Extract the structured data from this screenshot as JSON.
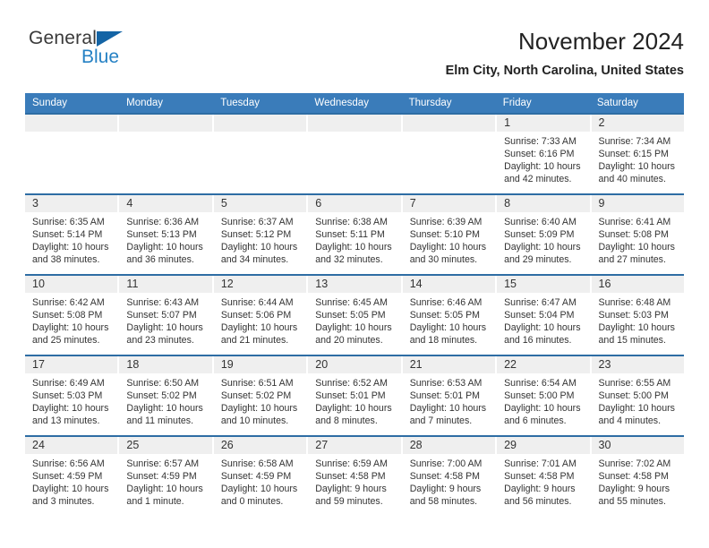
{
  "brand": {
    "line1": "General",
    "line2": "Blue",
    "triangle_color": "#1464a5",
    "blue_text_color": "#2581c4"
  },
  "header": {
    "title": "November 2024",
    "subtitle": "Elm City, North Carolina, United States"
  },
  "theme": {
    "header_blue": "#3a7cba",
    "row_rule_blue": "#2e6da4",
    "daynum_gray": "#efefef"
  },
  "weekday_headers": [
    "Sunday",
    "Monday",
    "Tuesday",
    "Wednesday",
    "Thursday",
    "Friday",
    "Saturday"
  ],
  "weeks": [
    [
      {
        "day": "",
        "sunrise": "",
        "sunset": "",
        "daylight1": "",
        "daylight2": ""
      },
      {
        "day": "",
        "sunrise": "",
        "sunset": "",
        "daylight1": "",
        "daylight2": ""
      },
      {
        "day": "",
        "sunrise": "",
        "sunset": "",
        "daylight1": "",
        "daylight2": ""
      },
      {
        "day": "",
        "sunrise": "",
        "sunset": "",
        "daylight1": "",
        "daylight2": ""
      },
      {
        "day": "",
        "sunrise": "",
        "sunset": "",
        "daylight1": "",
        "daylight2": ""
      },
      {
        "day": "1",
        "sunrise": "Sunrise: 7:33 AM",
        "sunset": "Sunset: 6:16 PM",
        "daylight1": "Daylight: 10 hours",
        "daylight2": "and 42 minutes."
      },
      {
        "day": "2",
        "sunrise": "Sunrise: 7:34 AM",
        "sunset": "Sunset: 6:15 PM",
        "daylight1": "Daylight: 10 hours",
        "daylight2": "and 40 minutes."
      }
    ],
    [
      {
        "day": "3",
        "sunrise": "Sunrise: 6:35 AM",
        "sunset": "Sunset: 5:14 PM",
        "daylight1": "Daylight: 10 hours",
        "daylight2": "and 38 minutes."
      },
      {
        "day": "4",
        "sunrise": "Sunrise: 6:36 AM",
        "sunset": "Sunset: 5:13 PM",
        "daylight1": "Daylight: 10 hours",
        "daylight2": "and 36 minutes."
      },
      {
        "day": "5",
        "sunrise": "Sunrise: 6:37 AM",
        "sunset": "Sunset: 5:12 PM",
        "daylight1": "Daylight: 10 hours",
        "daylight2": "and 34 minutes."
      },
      {
        "day": "6",
        "sunrise": "Sunrise: 6:38 AM",
        "sunset": "Sunset: 5:11 PM",
        "daylight1": "Daylight: 10 hours",
        "daylight2": "and 32 minutes."
      },
      {
        "day": "7",
        "sunrise": "Sunrise: 6:39 AM",
        "sunset": "Sunset: 5:10 PM",
        "daylight1": "Daylight: 10 hours",
        "daylight2": "and 30 minutes."
      },
      {
        "day": "8",
        "sunrise": "Sunrise: 6:40 AM",
        "sunset": "Sunset: 5:09 PM",
        "daylight1": "Daylight: 10 hours",
        "daylight2": "and 29 minutes."
      },
      {
        "day": "9",
        "sunrise": "Sunrise: 6:41 AM",
        "sunset": "Sunset: 5:08 PM",
        "daylight1": "Daylight: 10 hours",
        "daylight2": "and 27 minutes."
      }
    ],
    [
      {
        "day": "10",
        "sunrise": "Sunrise: 6:42 AM",
        "sunset": "Sunset: 5:08 PM",
        "daylight1": "Daylight: 10 hours",
        "daylight2": "and 25 minutes."
      },
      {
        "day": "11",
        "sunrise": "Sunrise: 6:43 AM",
        "sunset": "Sunset: 5:07 PM",
        "daylight1": "Daylight: 10 hours",
        "daylight2": "and 23 minutes."
      },
      {
        "day": "12",
        "sunrise": "Sunrise: 6:44 AM",
        "sunset": "Sunset: 5:06 PM",
        "daylight1": "Daylight: 10 hours",
        "daylight2": "and 21 minutes."
      },
      {
        "day": "13",
        "sunrise": "Sunrise: 6:45 AM",
        "sunset": "Sunset: 5:05 PM",
        "daylight1": "Daylight: 10 hours",
        "daylight2": "and 20 minutes."
      },
      {
        "day": "14",
        "sunrise": "Sunrise: 6:46 AM",
        "sunset": "Sunset: 5:05 PM",
        "daylight1": "Daylight: 10 hours",
        "daylight2": "and 18 minutes."
      },
      {
        "day": "15",
        "sunrise": "Sunrise: 6:47 AM",
        "sunset": "Sunset: 5:04 PM",
        "daylight1": "Daylight: 10 hours",
        "daylight2": "and 16 minutes."
      },
      {
        "day": "16",
        "sunrise": "Sunrise: 6:48 AM",
        "sunset": "Sunset: 5:03 PM",
        "daylight1": "Daylight: 10 hours",
        "daylight2": "and 15 minutes."
      }
    ],
    [
      {
        "day": "17",
        "sunrise": "Sunrise: 6:49 AM",
        "sunset": "Sunset: 5:03 PM",
        "daylight1": "Daylight: 10 hours",
        "daylight2": "and 13 minutes."
      },
      {
        "day": "18",
        "sunrise": "Sunrise: 6:50 AM",
        "sunset": "Sunset: 5:02 PM",
        "daylight1": "Daylight: 10 hours",
        "daylight2": "and 11 minutes."
      },
      {
        "day": "19",
        "sunrise": "Sunrise: 6:51 AM",
        "sunset": "Sunset: 5:02 PM",
        "daylight1": "Daylight: 10 hours",
        "daylight2": "and 10 minutes."
      },
      {
        "day": "20",
        "sunrise": "Sunrise: 6:52 AM",
        "sunset": "Sunset: 5:01 PM",
        "daylight1": "Daylight: 10 hours",
        "daylight2": "and 8 minutes."
      },
      {
        "day": "21",
        "sunrise": "Sunrise: 6:53 AM",
        "sunset": "Sunset: 5:01 PM",
        "daylight1": "Daylight: 10 hours",
        "daylight2": "and 7 minutes."
      },
      {
        "day": "22",
        "sunrise": "Sunrise: 6:54 AM",
        "sunset": "Sunset: 5:00 PM",
        "daylight1": "Daylight: 10 hours",
        "daylight2": "and 6 minutes."
      },
      {
        "day": "23",
        "sunrise": "Sunrise: 6:55 AM",
        "sunset": "Sunset: 5:00 PM",
        "daylight1": "Daylight: 10 hours",
        "daylight2": "and 4 minutes."
      }
    ],
    [
      {
        "day": "24",
        "sunrise": "Sunrise: 6:56 AM",
        "sunset": "Sunset: 4:59 PM",
        "daylight1": "Daylight: 10 hours",
        "daylight2": "and 3 minutes."
      },
      {
        "day": "25",
        "sunrise": "Sunrise: 6:57 AM",
        "sunset": "Sunset: 4:59 PM",
        "daylight1": "Daylight: 10 hours",
        "daylight2": "and 1 minute."
      },
      {
        "day": "26",
        "sunrise": "Sunrise: 6:58 AM",
        "sunset": "Sunset: 4:59 PM",
        "daylight1": "Daylight: 10 hours",
        "daylight2": "and 0 minutes."
      },
      {
        "day": "27",
        "sunrise": "Sunrise: 6:59 AM",
        "sunset": "Sunset: 4:58 PM",
        "daylight1": "Daylight: 9 hours",
        "daylight2": "and 59 minutes."
      },
      {
        "day": "28",
        "sunrise": "Sunrise: 7:00 AM",
        "sunset": "Sunset: 4:58 PM",
        "daylight1": "Daylight: 9 hours",
        "daylight2": "and 58 minutes."
      },
      {
        "day": "29",
        "sunrise": "Sunrise: 7:01 AM",
        "sunset": "Sunset: 4:58 PM",
        "daylight1": "Daylight: 9 hours",
        "daylight2": "and 56 minutes."
      },
      {
        "day": "30",
        "sunrise": "Sunrise: 7:02 AM",
        "sunset": "Sunset: 4:58 PM",
        "daylight1": "Daylight: 9 hours",
        "daylight2": "and 55 minutes."
      }
    ]
  ]
}
